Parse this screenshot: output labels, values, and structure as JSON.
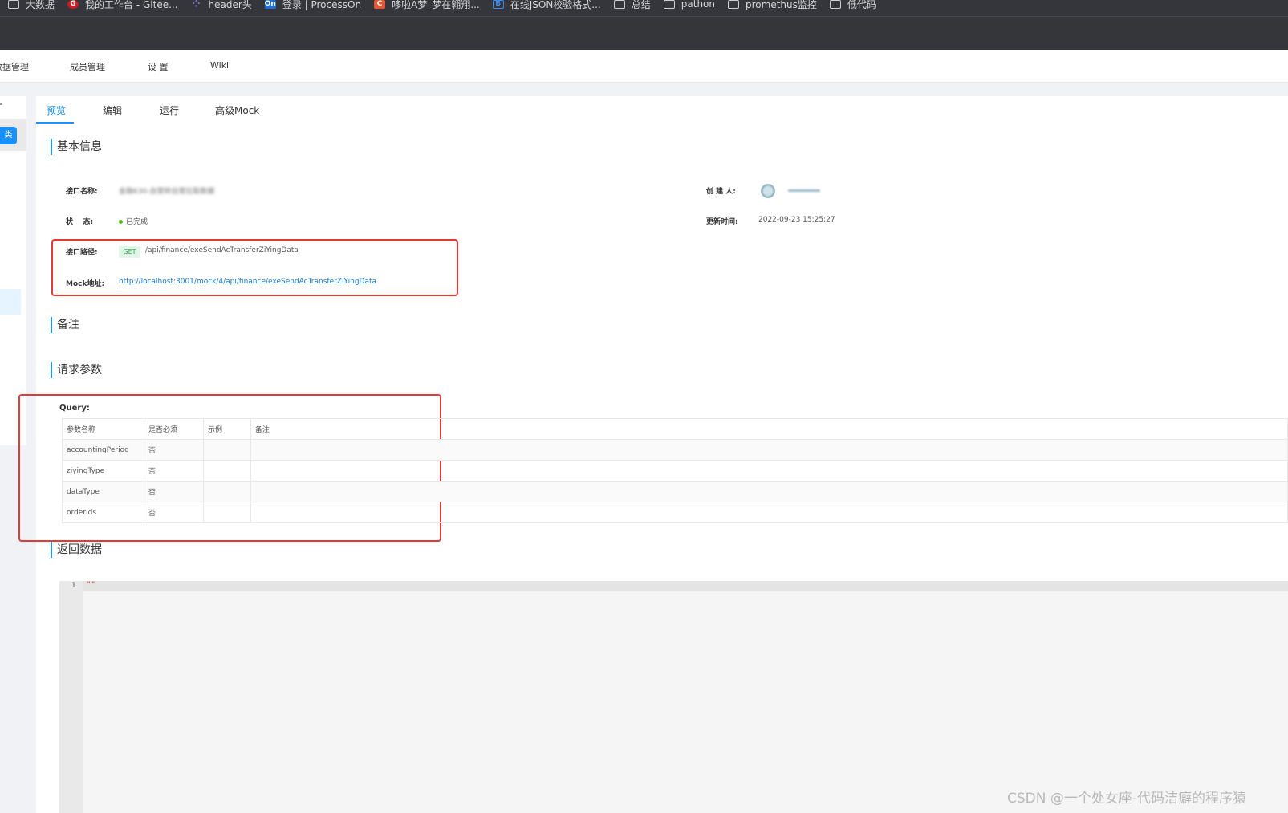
{
  "bookmarks": [
    {
      "label": "大数据",
      "icon": "folder-icon"
    },
    {
      "label": "我的工作台 - Gitee...",
      "icon": "gitee-icon"
    },
    {
      "label": "header头",
      "icon": "dots-icon"
    },
    {
      "label": "登录 | ProcessOn",
      "icon": "processon-icon"
    },
    {
      "label": "哆啦A梦_梦在翱翔...",
      "icon": "csdn-icon"
    },
    {
      "label": "在线JSON校验格式...",
      "icon": "json-icon"
    },
    {
      "label": "总结",
      "icon": "folder-icon"
    },
    {
      "label": "pathon",
      "icon": "folder-icon"
    },
    {
      "label": "promethus监控",
      "icon": "folder-icon"
    },
    {
      "label": "低代码",
      "icon": "folder-icon"
    }
  ],
  "bookmark_icon_text": {
    "gitee": "G",
    "dots": "⁘",
    "processon": "On",
    "csdn": "C",
    "json": "B"
  },
  "nav": {
    "data_mgmt": "数据管理",
    "members": "成员管理",
    "settings": "设 置",
    "wiki": "Wiki"
  },
  "sidebar": {
    "button_label": "类"
  },
  "tabs": {
    "preview": "预览",
    "edit": "编辑",
    "run": "运行",
    "advanced_mock": "高级Mock"
  },
  "sections": {
    "basic_info": "基本信息",
    "remark": "备注",
    "request_params": "请求参数",
    "response": "返回数据"
  },
  "basic": {
    "name_label": "接口名称:",
    "name_value": "金融630-自营转自营拉取数据",
    "creator_label": "创 建 人:",
    "status_label": "状    态:",
    "status_value": "已完成",
    "updated_label": "更新时间:",
    "updated_value": "2022-09-23 15:25:27",
    "path_label": "接口路径:",
    "method": "GET",
    "path_value": "/api/finance/exeSendAcTransferZiYingData",
    "mock_label": "Mock地址:",
    "mock_value": "http://localhost:3001/mock/4/api/finance/exeSendAcTransferZiYingData"
  },
  "query": {
    "label": "Query:",
    "headers": [
      "参数名称",
      "是否必须",
      "示例",
      "备注"
    ],
    "rows": [
      [
        "accountingPeriod",
        "否",
        "",
        ""
      ],
      [
        "ziyingType",
        "否",
        "",
        ""
      ],
      [
        "dataType",
        "否",
        "",
        ""
      ],
      [
        "orderIds",
        "否",
        "",
        ""
      ]
    ]
  },
  "editor": {
    "line_number": "1",
    "code": "\"\""
  },
  "watermark": "CSDN @一个处女座-代码洁癖的程序猿",
  "colors": {
    "accent": "#1890ff",
    "highlight_box": "#e53935",
    "method_tag": "#2ea35a"
  }
}
